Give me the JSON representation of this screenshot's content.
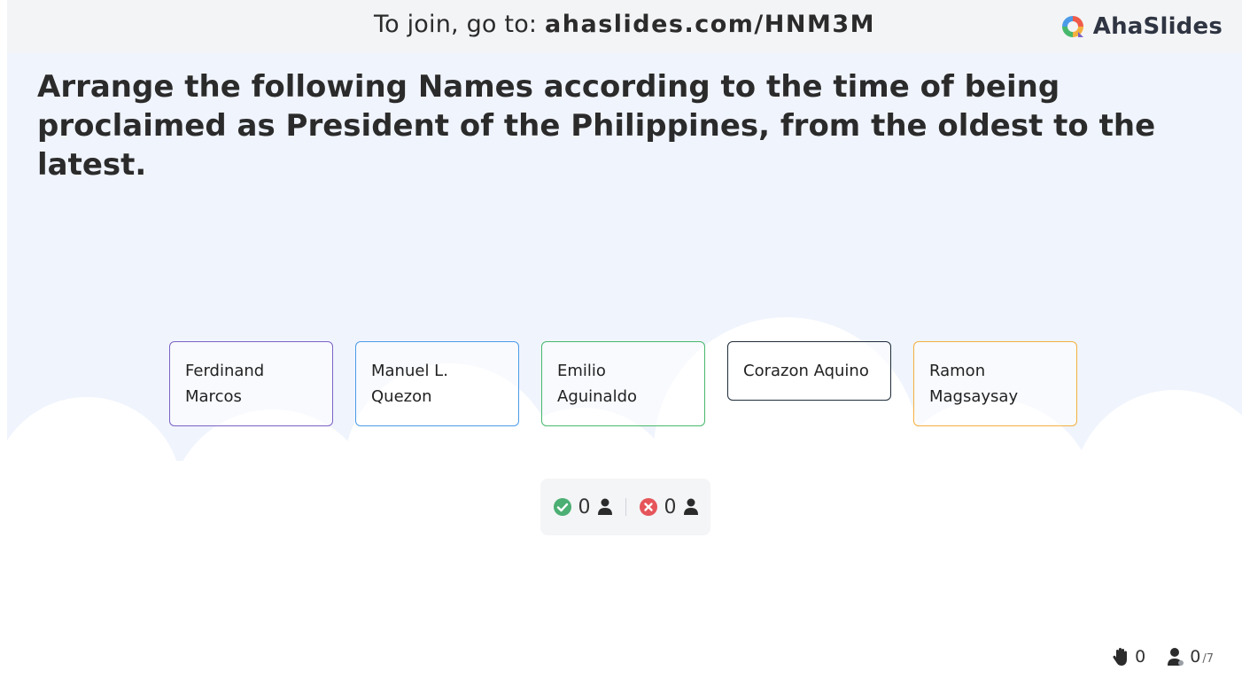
{
  "header": {
    "join_prefix": "To join, go to:",
    "join_url": "ahaslides.com/HNM3M",
    "brand": "AhaSlides"
  },
  "question": {
    "text": "Arrange the following Names according to the time of being proclaimed as President of the Philippines, from the oldest to the latest."
  },
  "items": [
    {
      "label": "Ferdinand Marcos",
      "color": "#7c62c4"
    },
    {
      "label": "Manuel L. Quezon",
      "color": "#4c9be8"
    },
    {
      "label": "Emilio Aguinaldo",
      "color": "#47b86c"
    },
    {
      "label": "Corazon Aquino",
      "color": "#1f2d3a"
    },
    {
      "label": "Ramon Magsaysay",
      "color": "#f4b03f"
    }
  ],
  "results": {
    "correct_count": "0",
    "incorrect_count": "0",
    "correct_icon": "check-circle-icon",
    "incorrect_icon": "x-circle-icon",
    "correct_color": "#4caf73",
    "incorrect_color": "#e5555a"
  },
  "footer": {
    "reactions_count": "0",
    "participants_count": "0",
    "participants_total": "/7"
  }
}
